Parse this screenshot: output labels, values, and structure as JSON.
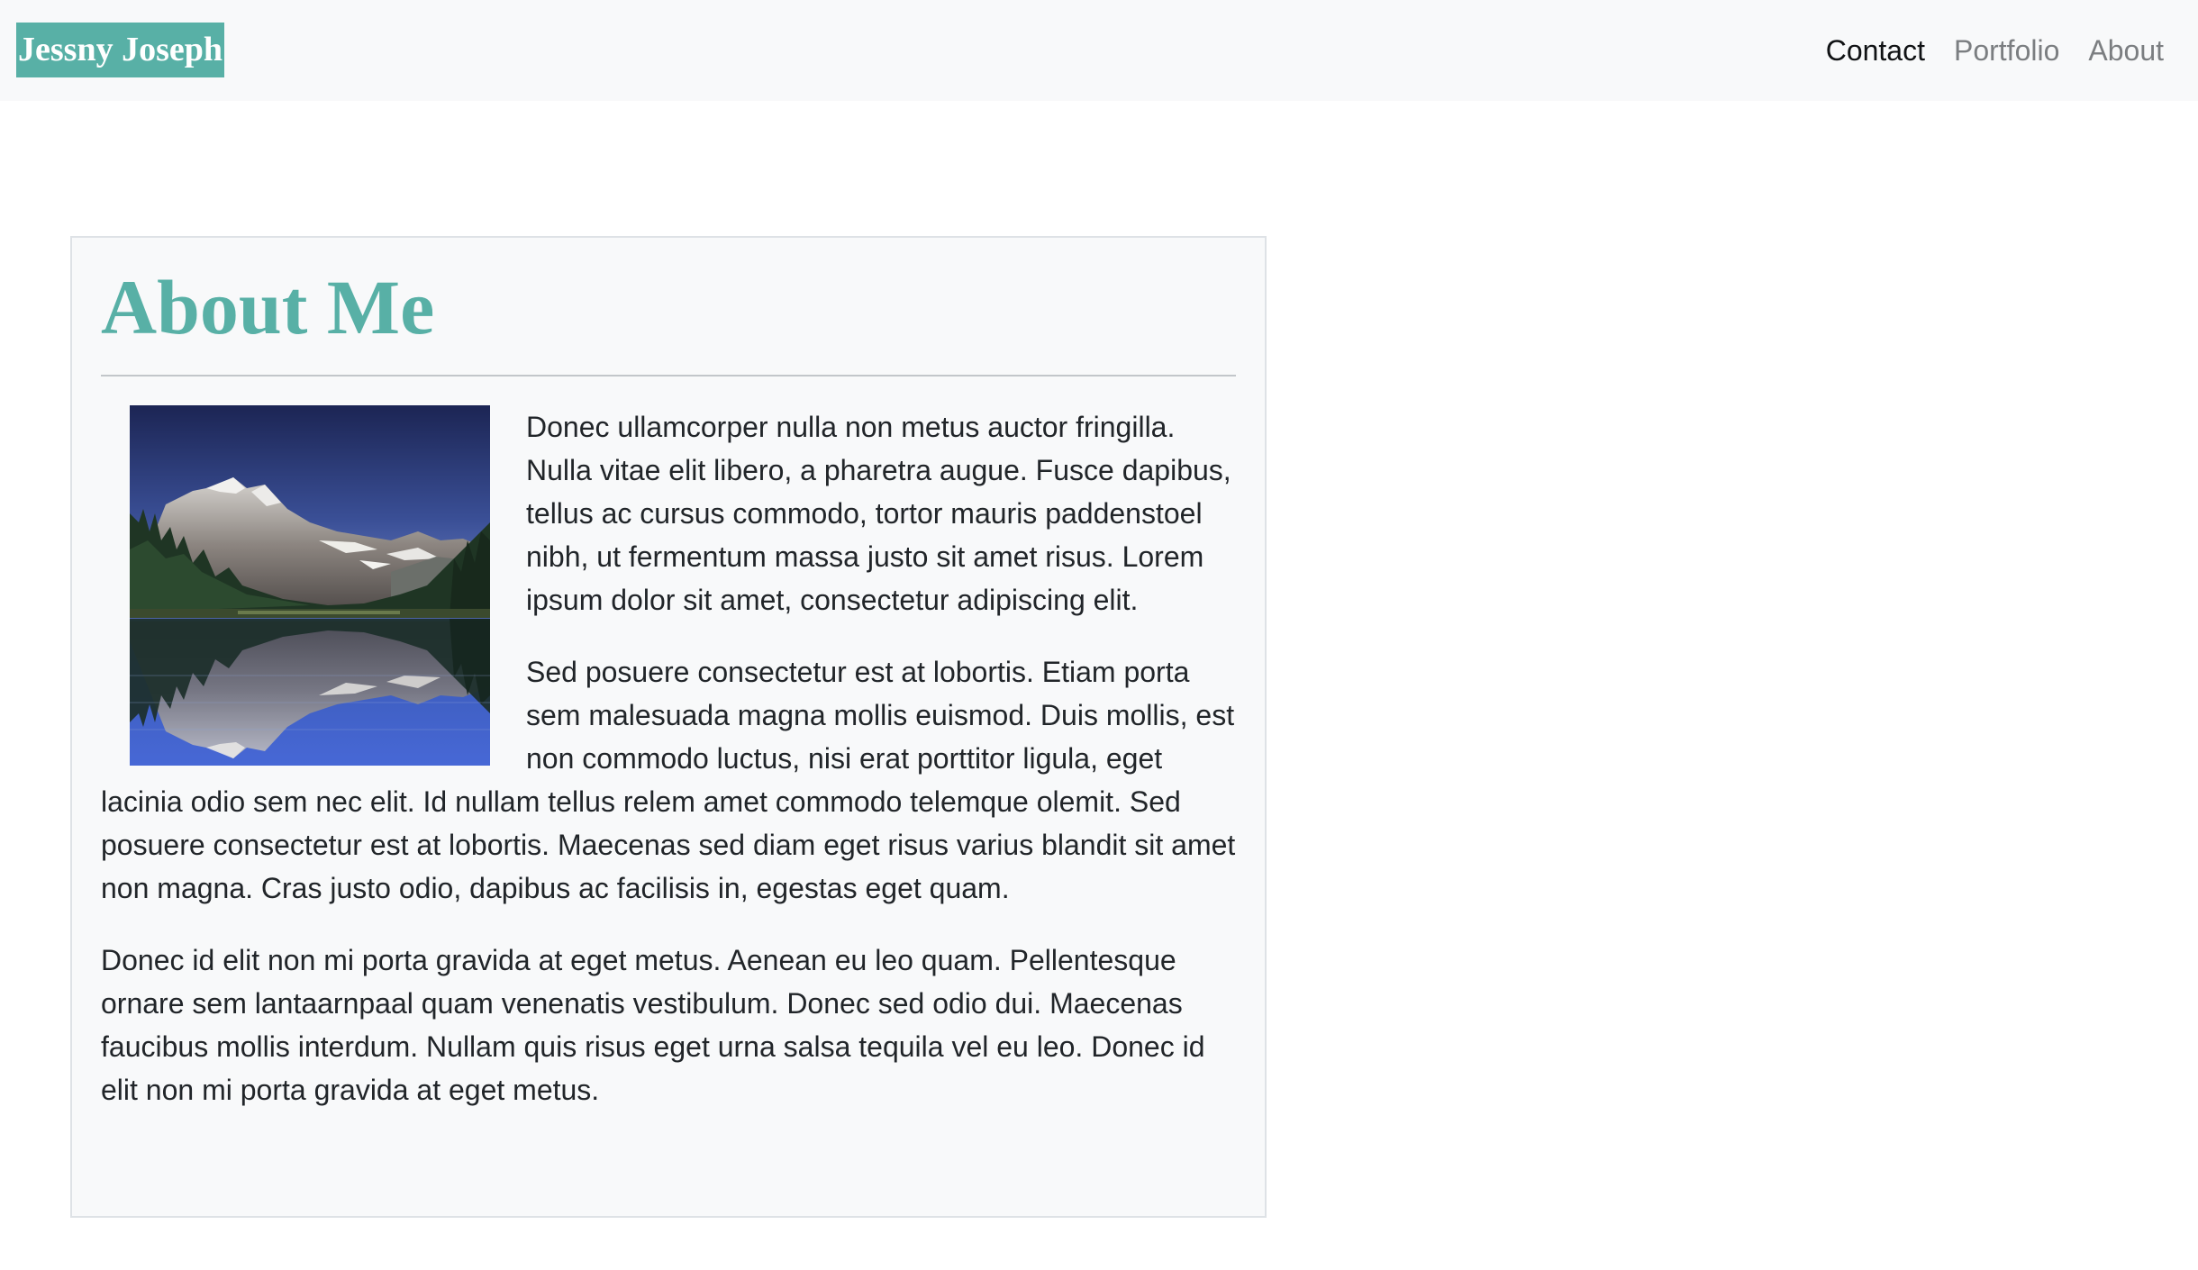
{
  "navbar": {
    "brand": "Jessny Joseph",
    "links": [
      {
        "label": "Contact",
        "active": true
      },
      {
        "label": "Portfolio",
        "active": false
      },
      {
        "label": "About",
        "active": false
      }
    ]
  },
  "about": {
    "title": "About Me",
    "image_alt": "mountain lake reflection",
    "paragraphs": [
      "Donec ullamcorper nulla non metus auctor fringilla. Nulla vitae elit libero, a pharetra augue. Fusce dapibus, tellus ac cursus commodo, tortor mauris paddenstoel nibh, ut fermentum massa justo sit amet risus. Lorem ipsum dolor sit amet, consectetur adipiscing elit.",
      "Sed posuere consectetur est at lobortis. Etiam porta sem malesuada magna mollis euismod. Duis mollis, est non commodo luctus, nisi erat porttitor ligula, eget lacinia odio sem nec elit. Id nullam tellus relem amet commodo telemque olemit. Sed posuere consectetur est at lobortis. Maecenas sed diam eget risus varius blandit sit amet non magna. Cras justo odio, dapibus ac facilisis in, egestas eget quam.",
      "Donec id elit non mi porta gravida at eget metus. Aenean eu leo quam. Pellentesque ornare sem lantaarnpaal quam venenatis vestibulum. Donec sed odio dui. Maecenas faucibus mollis interdum. Nullam quis risus eget urna salsa tequila vel eu leo. Donec id elit non mi porta gravida at eget metus."
    ]
  },
  "colors": {
    "brand": "#58b0a6",
    "navbar_bg": "#f8f9fa",
    "nav_active": "#101214",
    "nav_inactive": "#7b7e81"
  }
}
